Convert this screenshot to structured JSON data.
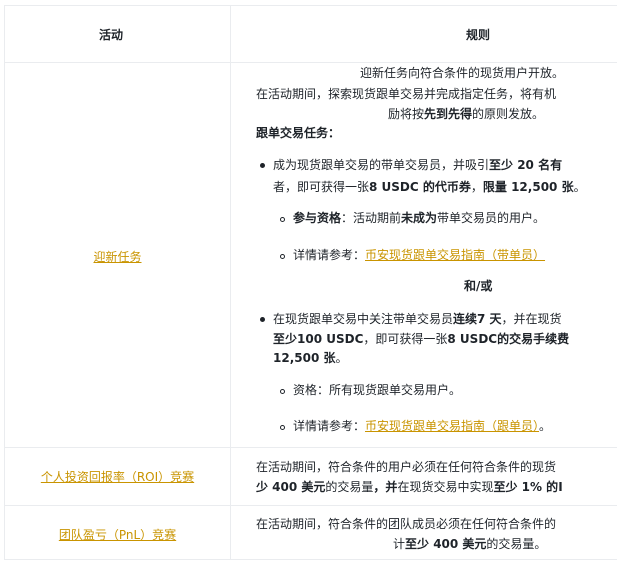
{
  "header": {
    "col_activity": "活动",
    "col_rules": "规则"
  },
  "rows": {
    "newcomer": {
      "activity": "迎新任务",
      "line1": "迎新任务向符合条件的现货用户开放。",
      "line2": "在活动期间，探索现货跟单交易并完成指定任务，将有机",
      "line3a": "励将按",
      "line3b": "先到先得",
      "line3c": "的原则发放。",
      "section_title": "跟单交易任务：",
      "b1_l1a": "成为现货跟单交易的带单交易员，并吸引",
      "b1_l1b": "至少 20 名有",
      "b1_l2a": "者，即可获得一张",
      "b1_l2b": "8 USDC 的代币券",
      "b1_l2c": "，",
      "b1_l2d": "限量 12,500 张",
      "b1_l2e": "。",
      "b1_s1a": "参与资格",
      "b1_s1b": "：活动期前",
      "b1_s1c": "未成为",
      "b1_s1d": "带单交易员的用户。",
      "b1_s2a": "详情请参考：",
      "b1_s2b": "币安现货跟单交易指南（带单员）",
      "andor": "和/或",
      "b2_l1a": "在现货跟单交易中关注带单交易员",
      "b2_l1b": "连续7 天",
      "b2_l1c": "，并在现货",
      "b2_l2a": "至少100 USDC",
      "b2_l2b": "，即可获得一张",
      "b2_l2c": "8 USDC的交易手续费",
      "b2_l3": "12,500 张",
      "b2_l3b": "。",
      "b2_s1": "资格：所有现货跟单交易用户。",
      "b2_s2a": "详情请参考：",
      "b2_s2b": "币安现货跟单交易指南（跟单员）",
      "b2_s2c": "。"
    },
    "roi": {
      "activity": "个人投资回报率（ROI）竞赛",
      "line1": "在活动期间，符合条件的用户必须在任何符合条件的现货",
      "line2a": "少 400 美元",
      "line2b": "的交易量",
      "line2c": "，并",
      "line2d": "在现货交易中实现",
      "line2e": "至少 1% 的",
      "line2f": "I"
    },
    "pnl": {
      "activity": "团队盈亏（PnL）竞赛",
      "line1": "在活动期间，符合条件的团队成员必须在任何符合条件的",
      "line2a": "计",
      "line2b": "至少 400 美元",
      "line2c": "的交易量。"
    }
  },
  "colors": {
    "link": "#c99400",
    "text": "#1e2329",
    "border": "#eaecef"
  }
}
